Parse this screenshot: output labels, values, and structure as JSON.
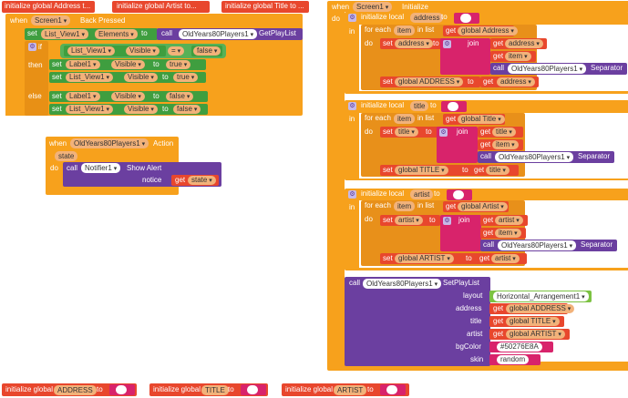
{
  "top_inits": {
    "address": "initialize global Address t...",
    "artist": "initialize global Artist to...",
    "title": "initialize global Title to ..."
  },
  "back_pressed": {
    "when": "when",
    "component": "Screen1",
    "event": "Back Pressed",
    "do": "do",
    "set": "set",
    "list_view": "List_View1",
    "elements": "Elements",
    "to": "to",
    "call": "call",
    "player": "OldYears80Players1",
    "get_playlist": "GetPlayList",
    "if": "if",
    "then": "then",
    "else": "else",
    "visible": "Visible",
    "eq": "=",
    "false": "false",
    "true": "true",
    "label": "Label1"
  },
  "action_event": {
    "when": "when",
    "component": "OldYears80Players1",
    "event": "Action",
    "param": "state",
    "do": "do",
    "call": "call",
    "notifier": "Notifier1",
    "method": "Show Alert",
    "notice": "notice",
    "get": "get",
    "state": "state"
  },
  "initialize": {
    "when": "when",
    "component": "Screen1",
    "event": "Initialize",
    "do": "do",
    "in": "in",
    "init_local": "initialize local",
    "to": "to",
    "for_each": "for each",
    "item": "item",
    "in_list": "in list",
    "get": "get",
    "set": "set",
    "join": "join",
    "call": "call",
    "player": "OldYears80Players1",
    "separator": "Separator",
    "address_var": "address",
    "title_var": "title",
    "artist_var": "artist",
    "global_address": "global Address",
    "global_title": "global Title",
    "global_artist": "global Artist",
    "global_ADDRESS": "global ADDRESS",
    "global_TITLE": "global TITLE",
    "global_ARTIST": "global ARTIST",
    "set_playlist": "SetPlayList",
    "layout": "layout",
    "layout_val": "Horizontal_Arrangement1",
    "address_lbl": "address",
    "title_lbl": "title",
    "artist_lbl": "artist",
    "bgcolor": "bgColor",
    "bgcolor_val": "#50276E8A",
    "skin": "skin",
    "skin_val": "random"
  },
  "bottom_inits": {
    "prefix": "initialize global",
    "to": "to",
    "address": "ADDRESS",
    "title": "TITLE",
    "artist": "ARTIST"
  },
  "colors": {
    "event": "#f7a11c",
    "component": "#3f9e3f",
    "procedure": "#6b3fa0",
    "variable": "#e8472d",
    "text": "#d8236b"
  }
}
